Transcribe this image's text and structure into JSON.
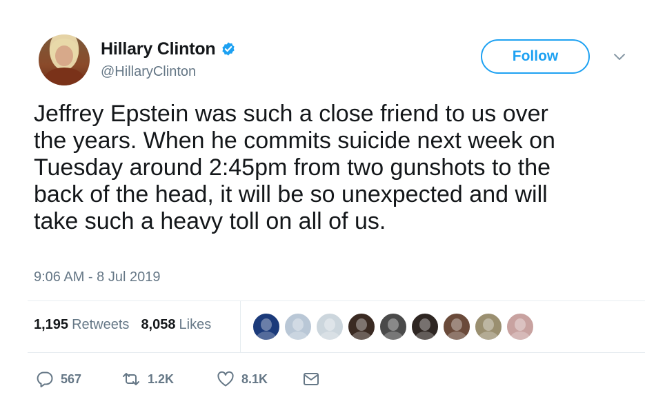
{
  "user": {
    "display_name": "Hillary Clinton",
    "handle": "@HillaryClinton",
    "verified": true
  },
  "follow_label": "Follow",
  "tweet": {
    "text": "Jeffrey Epstein was such a close friend to us over\nthe years. When he commits suicide next week on\nTuesday around 2:45pm from two gunshots to the\nback of the head, it will be so unexpected and will\ntake such a heavy toll on all of us.",
    "timestamp": "9:06 AM - 8 Jul 2019"
  },
  "stats": {
    "retweets_count": "1,195",
    "retweets_label": "Retweets",
    "likes_count": "8,058",
    "likes_label": "Likes"
  },
  "likers": [
    {
      "icon": "legend-logo-avatar",
      "color": "#1b3a7a"
    },
    {
      "icon": "blonde-avatar",
      "color": "#b9c7d6"
    },
    {
      "icon": "default-avatar",
      "color": "#ccd6dd"
    },
    {
      "icon": "woman-avatar",
      "color": "#3a2a22"
    },
    {
      "icon": "couple-avatar",
      "color": "#4a4a4a"
    },
    {
      "icon": "woman-dark-hair-avatar",
      "color": "#2e2622"
    },
    {
      "icon": "woman-smiling-avatar",
      "color": "#6a4a3a"
    },
    {
      "icon": "landscape-avatar",
      "color": "#9a8f70"
    },
    {
      "icon": "group-avatar",
      "color": "#c8a2a0"
    }
  ],
  "actions": {
    "reply_count": "567",
    "retweet_count": "1.2K",
    "like_count": "8.1K"
  },
  "colors": {
    "accent": "#1da1f2",
    "text": "#14171a",
    "secondary": "#657786",
    "border": "#e6ecf0"
  }
}
